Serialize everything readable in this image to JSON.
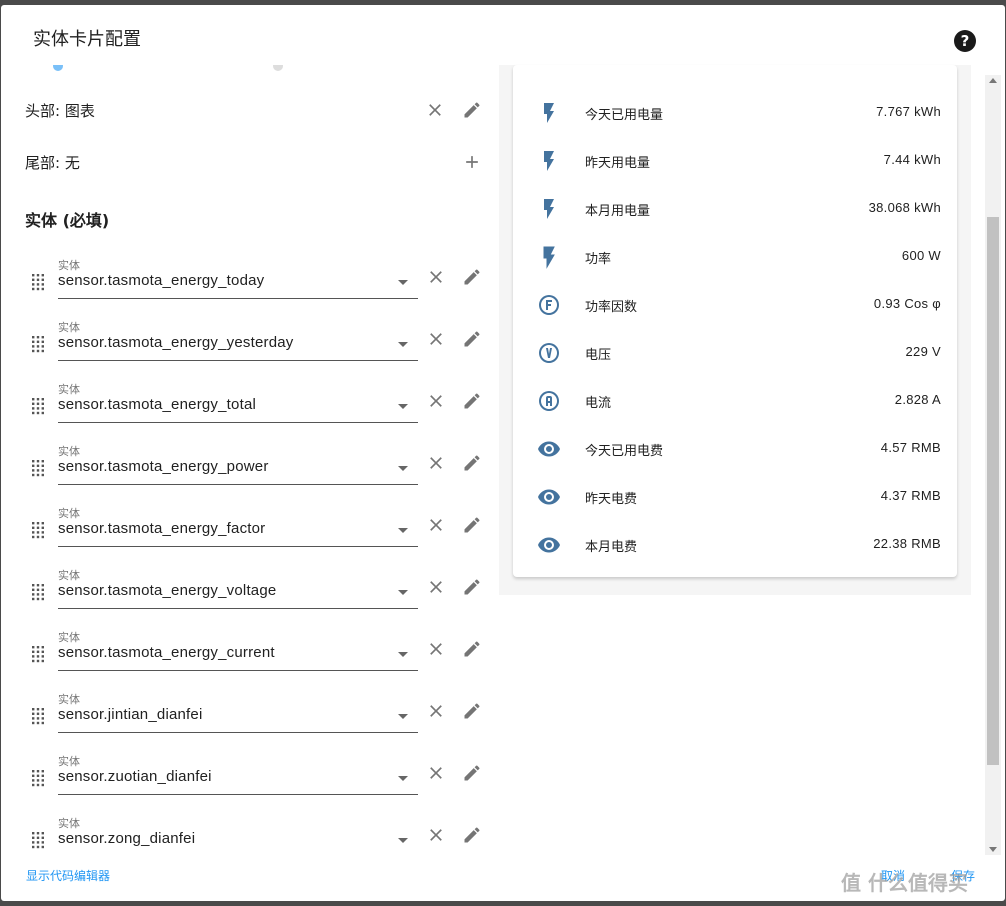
{
  "dialog": {
    "title": "实体卡片配置",
    "help_icon": "question-circle-icon"
  },
  "config": {
    "header": {
      "label": "头部: 图表"
    },
    "footer": {
      "label": "尾部: 无"
    },
    "entities_title": "实体 (必填)",
    "entity_field_label": "实体",
    "entities": [
      "sensor.tasmota_energy_today",
      "sensor.tasmota_energy_yesterday",
      "sensor.tasmota_energy_total",
      "sensor.tasmota_energy_power",
      "sensor.tasmota_energy_factor",
      "sensor.tasmota_energy_voltage",
      "sensor.tasmota_energy_current",
      "sensor.jintian_dianfei",
      "sensor.zuotian_dianfei",
      "sensor.zong_dianfei"
    ]
  },
  "preview": {
    "rows": [
      {
        "icon": "flash-icon",
        "name": "今天已用电量",
        "value": "7.767 kWh"
      },
      {
        "icon": "flash-icon",
        "name": "昨天用电量",
        "value": "7.44 kWh"
      },
      {
        "icon": "flash-icon",
        "name": "本月用电量",
        "value": "38.068 kWh"
      },
      {
        "icon": "flash-bold-icon",
        "name": "功率",
        "value": "600 W"
      },
      {
        "icon": "alpha-f-circle-icon",
        "name": "功率因数",
        "value": "0.93 Cos φ"
      },
      {
        "icon": "alpha-v-circle-icon",
        "name": "电压",
        "value": "229 V"
      },
      {
        "icon": "alpha-a-circle-icon",
        "name": "电流",
        "value": "2.828 A"
      },
      {
        "icon": "eye-icon",
        "name": "今天已用电费",
        "value": "4.57 RMB"
      },
      {
        "icon": "eye-icon",
        "name": "昨天电费",
        "value": "4.37 RMB"
      },
      {
        "icon": "eye-icon",
        "name": "本月电费",
        "value": "22.38 RMB"
      }
    ]
  },
  "footer": {
    "code_editor_label": "显示代码编辑器",
    "cancel_label": "取消",
    "save_label": "保存"
  },
  "watermark": "值 什么值得买",
  "colors": {
    "icon": "#44739e",
    "link": "#2196f3"
  }
}
